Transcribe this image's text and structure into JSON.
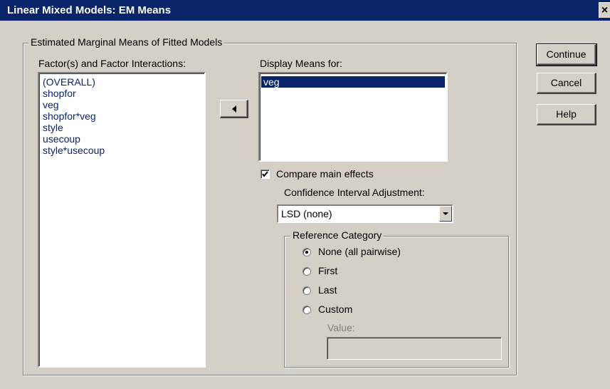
{
  "window": {
    "title": "Linear Mixed Models: EM Means",
    "close_label": "×"
  },
  "group_main": {
    "legend": "Estimated Marginal Means of Fitted Models"
  },
  "factors": {
    "label": "Factor(s) and Factor Interactions:",
    "items": [
      "(OVERALL)",
      "shopfor",
      "veg",
      "shopfor*veg",
      "style",
      "usecoup",
      "style*usecoup"
    ]
  },
  "move_button": {
    "icon": "left-arrow-icon"
  },
  "display_means": {
    "label": "Display Means for:",
    "items": [
      "veg"
    ],
    "selected_index": 0
  },
  "compare": {
    "label": "Compare main effects",
    "checked": true
  },
  "ci_adjustment": {
    "label": "Confidence Interval Adjustment:",
    "value": "LSD (none)"
  },
  "reference_category": {
    "legend": "Reference Category",
    "options": [
      "None (all pairwise)",
      "First",
      "Last",
      "Custom"
    ],
    "selected_index": 0,
    "value_label": "Value:",
    "value": ""
  },
  "buttons": {
    "continue": "Continue",
    "cancel": "Cancel",
    "help": "Help"
  },
  "colors": {
    "title_bar": "#0a246a",
    "dialog_bg": "#d4d0c8",
    "selection": "#0a246a"
  }
}
